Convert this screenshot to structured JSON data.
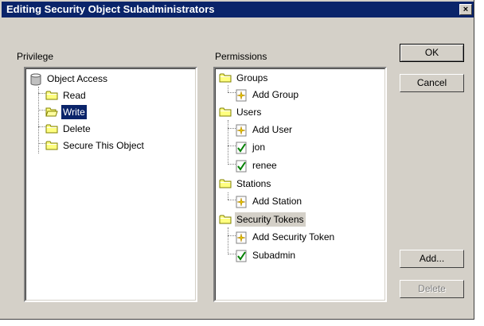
{
  "window": {
    "title": "Editing Security Object Subadministrators",
    "close_label": "×"
  },
  "privilege": {
    "label": "Privilege",
    "root": "Object Access",
    "items": [
      "Read",
      "Write",
      "Delete",
      "Secure This Object"
    ],
    "selected": "Write"
  },
  "permissions": {
    "label": "Permissions",
    "groups": {
      "label": "Groups",
      "children": [
        "Add Group"
      ]
    },
    "users": {
      "label": "Users",
      "children": [
        "Add User",
        "jon",
        "renee"
      ]
    },
    "stations": {
      "label": "Stations",
      "children": [
        "Add Station"
      ]
    },
    "security_tokens": {
      "label": "Security Tokens",
      "children": [
        "Add Security Token",
        "Subadmin"
      ]
    }
  },
  "buttons": {
    "ok": "OK",
    "cancel": "Cancel",
    "add": "Add...",
    "delete": "Delete"
  },
  "colors": {
    "titlebar": "#0a246a",
    "face": "#d4d0c8",
    "selection": "#0a246a"
  }
}
